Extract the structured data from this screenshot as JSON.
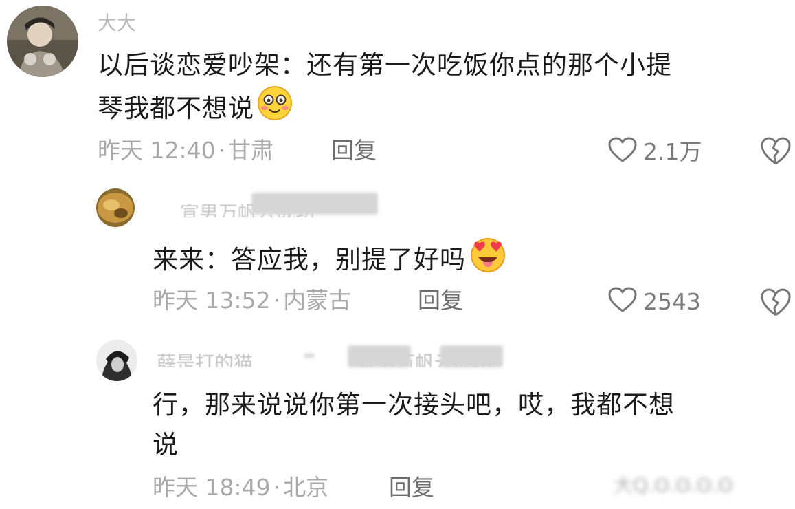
{
  "comments": [
    {
      "username": "大大",
      "content_lines": [
        "以后谈恋爱吵架：还有第一次吃饭你点的那个小提",
        "琴我都不想说"
      ],
      "emoji": "blushing-face-icon",
      "time": "昨天 12:40",
      "location": "甘肃",
      "reply_label": "回复",
      "likes": "2.1万"
    },
    {
      "username": "",
      "username_partial": "宣男万帆云成功",
      "content_lines": [
        "来来：答应我，别提了好吗"
      ],
      "emoji": "heart-eyes-tongue-face-icon",
      "time": "昨天 13:52",
      "location": "内蒙古",
      "reply_label": "回复",
      "likes": "2543"
    },
    {
      "username": "",
      "username_partial": "薛是打的猫",
      "username_partial2": "宣男万帆云成功",
      "content_lines": [
        "行，那来说说你第一次接头吧，哎，我都不想",
        "说"
      ],
      "time": "昨天 18:49",
      "location": "北京",
      "reply_label": "回复"
    }
  ],
  "separator": "·",
  "watermark": "大Q.ʘ.ʘ.ʘ.ʘ"
}
